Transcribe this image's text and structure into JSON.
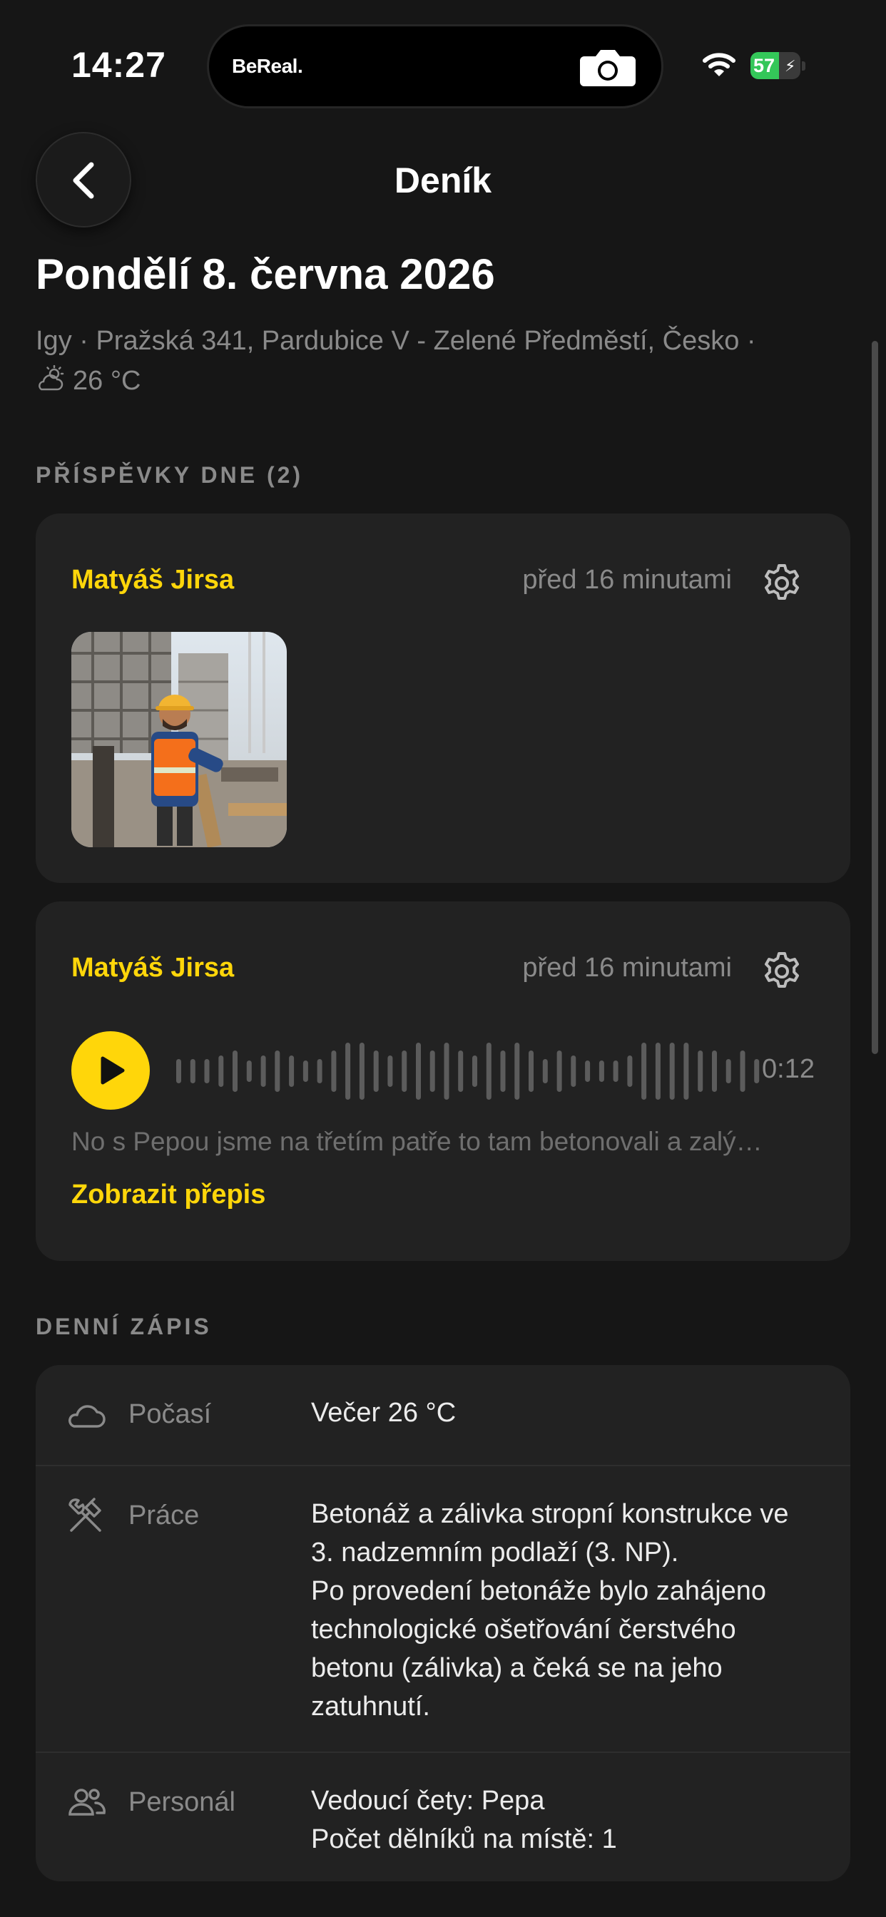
{
  "status_bar": {
    "time": "14:27",
    "island_app": "BeReal.",
    "battery_level": "57",
    "battery_fraction": 0.57,
    "battery_color": "#34c759"
  },
  "header": {
    "title": "Deník",
    "back_icon": "chevron-left-icon"
  },
  "day": {
    "date": "Pondělí 8. června 2026",
    "location": "Igy · Pražská 341, Pardubice V - Zelené Předměstí, Česko ·",
    "weather_icon": "partly-cloudy-icon",
    "temperature": "26 °C"
  },
  "posts_section": {
    "label": "PŘÍSPĚVKY DNE (2)",
    "posts": [
      {
        "author": "Matyáš Jirsa",
        "time": "před 16 minutami",
        "type": "photo",
        "settings_icon": "gear-icon"
      },
      {
        "author": "Matyáš Jirsa",
        "time": "před 16 minutami",
        "type": "audio",
        "duration": "0:12",
        "transcript_preview": "No s Pepou jsme na třetím patře to tam betonovali a zalý…",
        "transcript_link": "Zobrazit přepis",
        "settings_icon": "gear-icon"
      }
    ]
  },
  "record_section": {
    "label": "DENNÍ ZÁPIS",
    "rows": [
      {
        "icon": "cloud-icon",
        "label": "Počasí",
        "value": "Večer 26 °C"
      },
      {
        "icon": "tools-icon",
        "label": "Práce",
        "value": "Betonáž a zálivka stropní konstrukce ve\n3. nadzemním podlaží (3. NP).\nPo provedení betonáže bylo zahájeno\ntechnologické ošetřování čerstvého\nbetonu (zálivka) a čeká se na jeho\nzatuhnutí."
      },
      {
        "icon": "people-icon",
        "label": "Personál",
        "value": "Vedoucí čety: Pepa\nPočet dělníků na místě: 1"
      }
    ]
  },
  "colors": {
    "accent": "#ffd60a",
    "background": "#161616",
    "card": "#222222",
    "muted_text": "#8a8a8a"
  }
}
